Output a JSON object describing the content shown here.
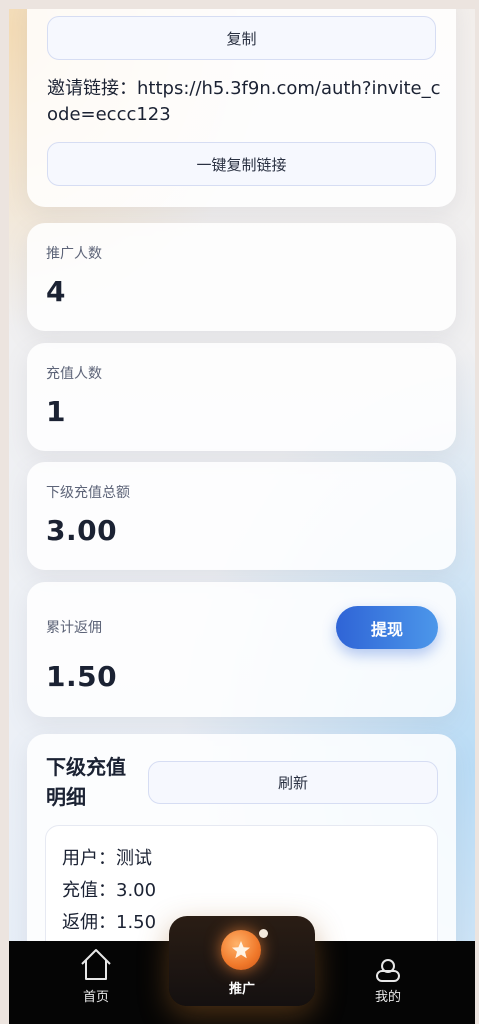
{
  "invite_card": {
    "copy_button_label": "复制",
    "invite_link_label": "邀请链接：",
    "invite_link_url": "https://h5.3f9n.com/auth?invite_code=eccc123",
    "copy_link_button_label": "一键复制链接"
  },
  "stats": {
    "promoted_count_label": "推广人数",
    "promoted_count_value": "4",
    "recharge_users_label": "充值人数",
    "recharge_users_value": "1",
    "sub_recharge_total_label": "下级充值总额",
    "sub_recharge_total_value": "3.00",
    "commission_label": "累计返佣",
    "commission_value": "1.50",
    "withdraw_button_label": "提现"
  },
  "details": {
    "title": "下级充值明细",
    "refresh_button_label": "刷新",
    "records": [
      {
        "user_label": "用户：",
        "user_value": "测试",
        "recharge_label": "充值：",
        "recharge_value": "3.00",
        "commission_label": "返佣：",
        "commission_value": "1.50"
      }
    ]
  },
  "tabbar": {
    "home_label": "首页",
    "promote_label": "推广",
    "mine_label": "我的",
    "active": "推广",
    "icons": {
      "home": "home-icon",
      "promote": "star-icon",
      "mine": "user-icon"
    }
  },
  "colors": {
    "accent_blue": "#2f64d6",
    "promote_orange": "#f0782a",
    "tabbar_bg": "#050505"
  }
}
